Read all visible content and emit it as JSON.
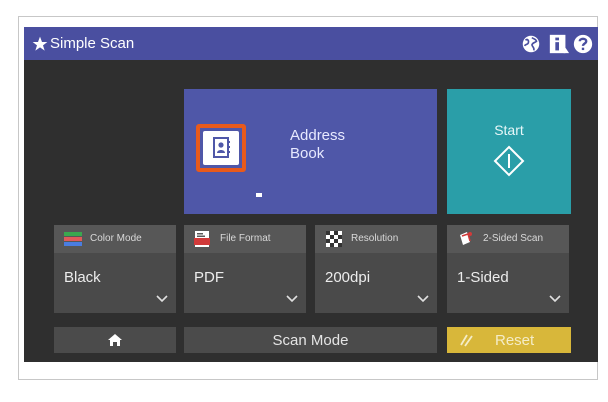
{
  "titlebar": {
    "title": "Simple Scan",
    "icons": [
      "star-icon",
      "globe-icon",
      "info-icon",
      "help-icon"
    ],
    "background": "#4a4fa0"
  },
  "main": {
    "address_book": {
      "label_line1": "Address",
      "label_line2": "Book",
      "icon": "address-book-icon",
      "highlight_color": "#e85a1b"
    },
    "start": {
      "label": "Start",
      "icon": "start-diamond-icon"
    }
  },
  "options": [
    {
      "label": "Color Mode",
      "value": "Black",
      "icon": "color-mode-icon"
    },
    {
      "label": "File Format",
      "value": "PDF",
      "icon": "pdf-file-icon"
    },
    {
      "label": "Resolution",
      "value": "200dpi",
      "icon": "resolution-icon"
    },
    {
      "label": "2-Sided Scan",
      "value": "1-Sided",
      "icon": "two-sided-icon"
    }
  ],
  "bottom": {
    "home_icon": "home-icon",
    "scan_mode_label": "Scan Mode",
    "reset_label": "Reset",
    "reset_icon": "reset-icon"
  },
  "colors": {
    "screen_bg": "#2f2f2f",
    "tile_address": "#4f57a8",
    "tile_start": "#2a9ea8",
    "reset": "#d8b73a"
  }
}
